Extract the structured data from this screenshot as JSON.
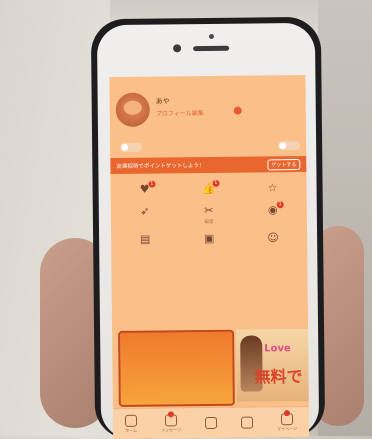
{
  "status": {
    "carrier": "",
    "time": "",
    "battery": ""
  },
  "profile": {
    "username": "あや",
    "edit_label": "プロフィール編集"
  },
  "notifications": {
    "title": "",
    "toggle1": "",
    "toggle2": ""
  },
  "banner": {
    "text": "友達招待でポイントゲットしよう！",
    "button": "ゲットする"
  },
  "menu": [
    {
      "label": "",
      "icon": "heart-icon",
      "glyph": "♥",
      "badge": "1"
    },
    {
      "label": "",
      "icon": "thumbs-up-icon",
      "glyph": "👍",
      "badge": "1"
    },
    {
      "label": "",
      "icon": "star-icon",
      "glyph": "☆",
      "badge": ""
    },
    {
      "label": "",
      "icon": "rocket-icon",
      "glyph": "➶",
      "badge": ""
    },
    {
      "label": "設定",
      "icon": "tools-icon",
      "glyph": "✂",
      "badge": ""
    },
    {
      "label": "",
      "icon": "coin-icon",
      "glyph": "◉",
      "badge": "1"
    },
    {
      "label": "",
      "icon": "list-icon",
      "glyph": "▤",
      "badge": ""
    },
    {
      "label": "",
      "icon": "present-icon",
      "glyph": "▣",
      "badge": ""
    },
    {
      "label": "",
      "icon": "smile-icon",
      "glyph": "☺",
      "badge": ""
    }
  ],
  "ads": {
    "left_top": "",
    "left_mid": "",
    "left_bottom": "",
    "right_top": "Love",
    "right_bottom": "無料で"
  },
  "tabbar": [
    {
      "label": "ホーム",
      "icon": "home-icon",
      "badge": false
    },
    {
      "label": "メッセージ",
      "icon": "message-icon",
      "badge": true
    },
    {
      "label": "",
      "icon": "points-icon",
      "badge": false
    },
    {
      "label": "",
      "icon": "board-icon",
      "badge": false
    },
    {
      "label": "マイページ",
      "icon": "mypage-icon",
      "badge": true
    }
  ]
}
